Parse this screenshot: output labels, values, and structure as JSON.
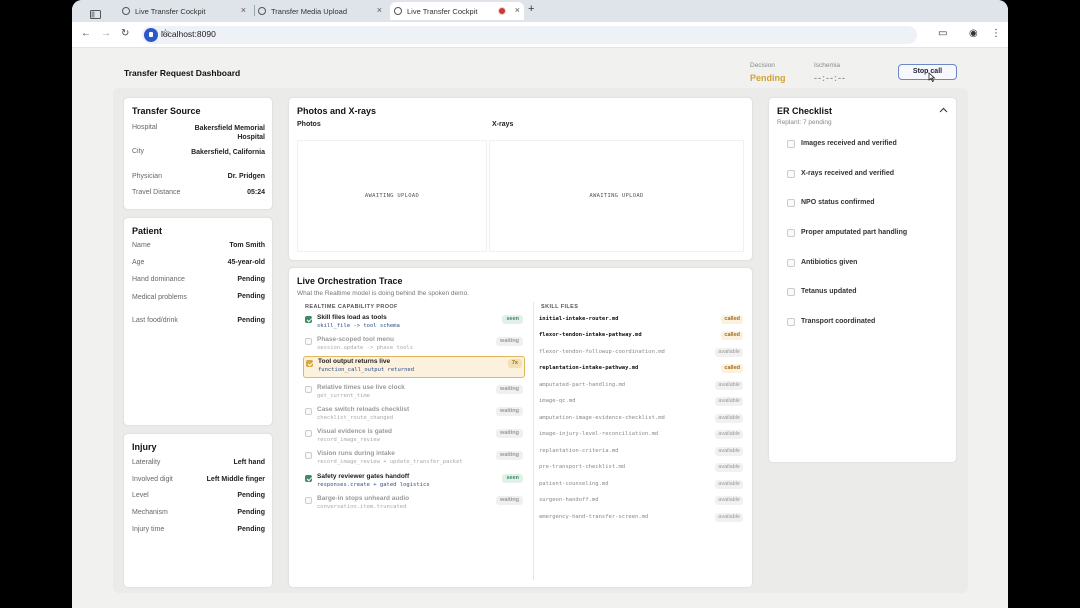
{
  "browser": {
    "tabs": [
      {
        "label": "Live Transfer Cockpit"
      },
      {
        "label": "Transfer Media Upload"
      },
      {
        "label": "Live Transfer Cockpit"
      }
    ],
    "url": "localhost:8090"
  },
  "page": {
    "title": "Transfer Request Dashboard",
    "decision_label": "Decision",
    "decision_value": "Pending",
    "ischemia_label": "Ischemia",
    "ischemia_value": "--:--:--",
    "stop_button": "Stop call"
  },
  "transfer_source": {
    "title": "Transfer Source",
    "rows": [
      {
        "label": "Hospital",
        "value": "Bakersfield Memorial Hospital"
      },
      {
        "label": "City",
        "value": "Bakersfield, California"
      },
      {
        "label": "Physician",
        "value": "Dr. Pridgen"
      },
      {
        "label": "Travel Distance",
        "value": "05:24"
      }
    ]
  },
  "patient": {
    "title": "Patient",
    "rows": [
      {
        "label": "Name",
        "value": "Tom Smith"
      },
      {
        "label": "Age",
        "value": "45-year-old"
      },
      {
        "label": "Hand dominance",
        "value": "Pending"
      },
      {
        "label": "Medical problems",
        "value": "Pending"
      },
      {
        "label": "Last food/drink",
        "value": "Pending"
      }
    ]
  },
  "injury": {
    "title": "Injury",
    "rows": [
      {
        "label": "Laterality",
        "value": "Left hand"
      },
      {
        "label": "Involved digit",
        "value": "Left Middle finger"
      },
      {
        "label": "Level",
        "value": "Pending"
      },
      {
        "label": "Mechanism",
        "value": "Pending"
      },
      {
        "label": "Injury time",
        "value": "Pending"
      }
    ]
  },
  "media": {
    "title": "Photos and X-rays",
    "photos_label": "Photos",
    "xrays_label": "X-rays",
    "awaiting_text": "AWAITING UPLOAD"
  },
  "trace": {
    "title": "Live Orchestration Trace",
    "subtitle": "What the Realtime model is doing behind the spoken demo.",
    "capability_header": "REALTIME CAPABILITY PROOF",
    "skills_header": "SKILL FILES",
    "capabilities": [
      {
        "title": "Skill files load as tools",
        "code": "skill_file -> tool schema",
        "status": "seen",
        "state": "done"
      },
      {
        "title": "Phase-scoped tool menu",
        "code": "session.update -> phase tools",
        "status": "waiting",
        "state": "dim"
      },
      {
        "title": "Tool output returns live",
        "code": "function_call_output returned",
        "status": "7x",
        "state": "active"
      },
      {
        "title": "Relative times use live clock",
        "code": "get_current_time",
        "status": "waiting",
        "state": "dim"
      },
      {
        "title": "Case switch reloads checklist",
        "code": "checklist_route_changed",
        "status": "waiting",
        "state": "dim"
      },
      {
        "title": "Visual evidence is gated",
        "code": "record_image_review",
        "status": "waiting",
        "state": "dim"
      },
      {
        "title": "Vision runs during intake",
        "code": "record_image_review + update_transfer_packet",
        "status": "waiting",
        "state": "dim"
      },
      {
        "title": "Safety reviewer gates handoff",
        "code": "responses.create + gated logistics",
        "status": "seen",
        "state": "done"
      },
      {
        "title": "Barge-in stops unheard audio",
        "code": "conversation.item.truncated",
        "status": "waiting",
        "state": "dim"
      }
    ],
    "skills": [
      {
        "name": "initial-intake-router.md",
        "status": "called"
      },
      {
        "name": "flexor-tendon-intake-pathway.md",
        "status": "called"
      },
      {
        "name": "flexor-tendon-followup-coordination.md",
        "status": "available"
      },
      {
        "name": "replantation-intake-pathway.md",
        "status": "called"
      },
      {
        "name": "amputated-part-handling.md",
        "status": "available"
      },
      {
        "name": "image-qc.md",
        "status": "available"
      },
      {
        "name": "amputation-image-evidence-checklist.md",
        "status": "available"
      },
      {
        "name": "image-injury-level-reconciliation.md",
        "status": "available"
      },
      {
        "name": "replantation-criteria.md",
        "status": "available"
      },
      {
        "name": "pre-transport-checklist.md",
        "status": "available"
      },
      {
        "name": "patient-counseling.md",
        "status": "available"
      },
      {
        "name": "surgeon-handoff.md",
        "status": "available"
      },
      {
        "name": "emergency-hand-transfer-screen.md",
        "status": "available"
      }
    ]
  },
  "er_checklist": {
    "title": "ER Checklist",
    "subtitle": "Replant: 7 pending",
    "items": [
      "Images received and verified",
      "X-rays received and verified",
      "NPO status confirmed",
      "Proper amputated part handling",
      "Antibiotics given",
      "Tetanus updated",
      "Transport coordinated"
    ]
  }
}
